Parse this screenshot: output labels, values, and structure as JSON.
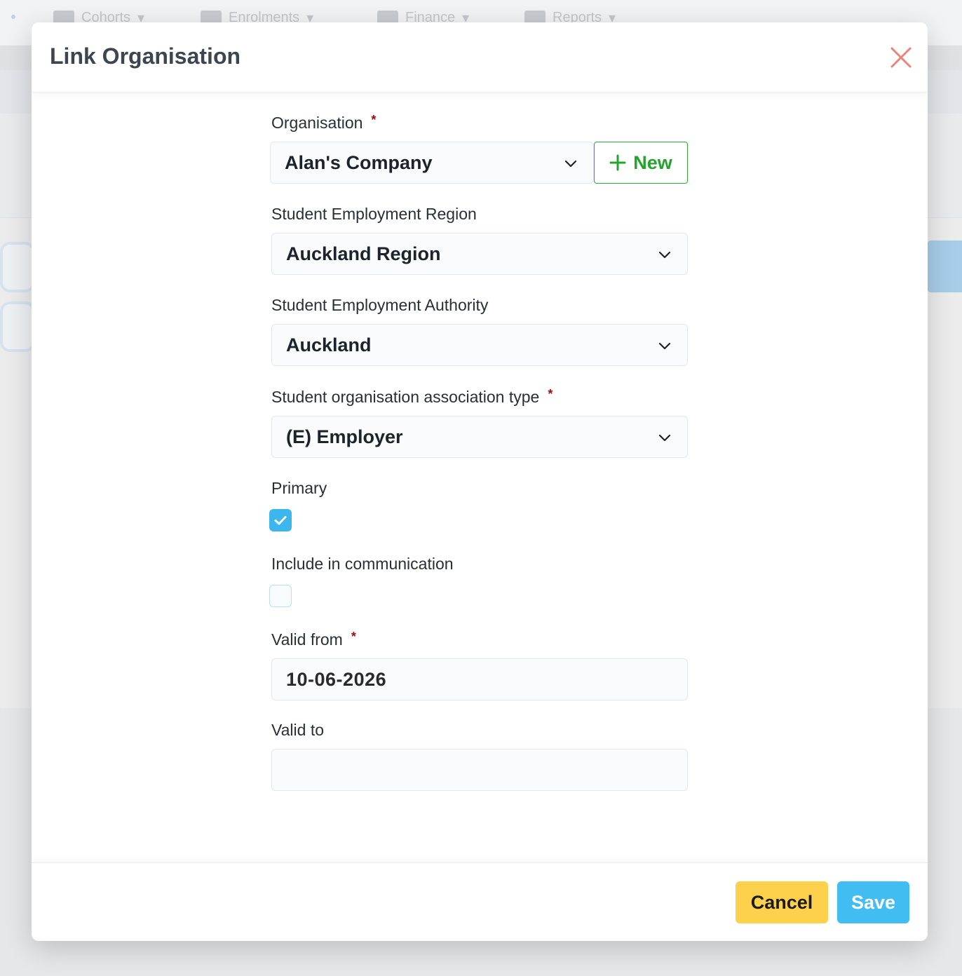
{
  "background_nav": {
    "items": [
      "Cohorts",
      "Enrolments",
      "Finance",
      "Reports"
    ]
  },
  "modal": {
    "title": "Link Organisation",
    "fields": {
      "organisation": {
        "label": "Organisation",
        "required_mark": "*",
        "value": "Alan's Company",
        "new_button_label": "New"
      },
      "region": {
        "label": "Student Employment Region",
        "value": "Auckland Region"
      },
      "authority": {
        "label": "Student Employment Authority",
        "value": "Auckland"
      },
      "association_type": {
        "label": "Student organisation association type",
        "required_mark": "*",
        "value": "(E) Employer"
      },
      "primary": {
        "label": "Primary",
        "checked": true
      },
      "include_in_communication": {
        "label": "Include in communication",
        "checked": false
      },
      "valid_from": {
        "label": "Valid from",
        "required_mark": "*",
        "value": "10-06-2026"
      },
      "valid_to": {
        "label": "Valid to",
        "value": ""
      }
    },
    "footer": {
      "cancel_label": "Cancel",
      "save_label": "Save"
    }
  },
  "colors": {
    "accent_blue": "#41bdf2",
    "cancel_yellow": "#fdd14b",
    "new_green": "#22a52f",
    "required_red": "#a10d0d",
    "close_red": "#e8827a"
  },
  "icons": {
    "close": "close-icon",
    "chevron": "chevron-down-icon",
    "plus": "plus-icon",
    "check": "check-icon"
  }
}
